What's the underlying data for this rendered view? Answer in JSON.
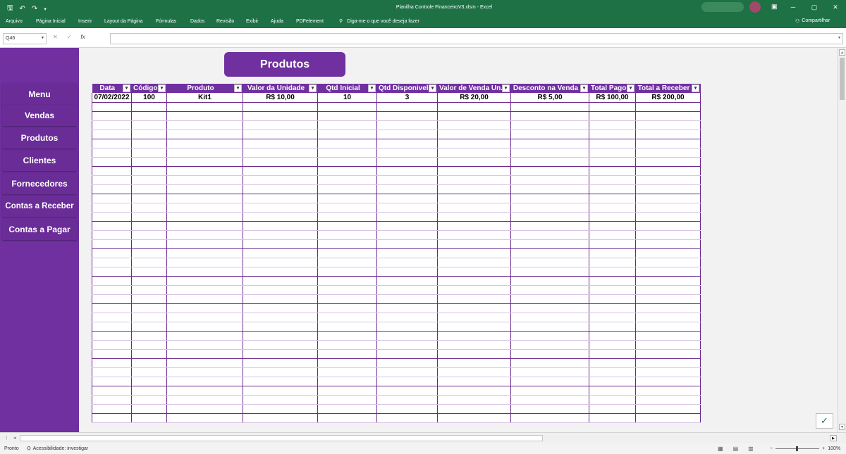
{
  "window": {
    "title": "Planilha Controle FinanceiroV3.xlsm  -  Excel",
    "qat_icons": [
      "save-icon",
      "undo-icon",
      "redo-icon",
      "customize-icon"
    ],
    "controls": [
      "ribbon-display-icon",
      "minimize-icon",
      "restore-icon",
      "close-icon"
    ]
  },
  "ribbon": {
    "tabs": [
      "Arquivo",
      "Página Inicial",
      "Inserir",
      "Layout da Página",
      "Fórmulas",
      "Dados",
      "Revisão",
      "Exibir",
      "Ajuda",
      "PDFelement"
    ],
    "tell_me": "Diga-me o que você deseja fazer",
    "share": "Compartilhar"
  },
  "formula_bar": {
    "name_box": "Q46",
    "cancel": "✕",
    "enter": "✓",
    "fx": "fx",
    "value": ""
  },
  "sidebar": {
    "items": [
      "Menu",
      "Vendas",
      "Produtos",
      "Clientes",
      "Fornecedores",
      "Contas a Receber",
      "Contas a Pagar"
    ]
  },
  "page_title": "Produtos",
  "table": {
    "headers": [
      "Data",
      "Código",
      "Produto",
      "Valor da Unidade",
      "Qtd Inicial",
      "Qtd Disponivel",
      "Valor de Venda Un.",
      "Desconto na Venda",
      "Total Pago",
      "Total a Receber"
    ],
    "rows": [
      [
        "07/02/2022",
        "100",
        "Kit1",
        "R$ 10,00",
        "10",
        "3",
        "R$ 20,00",
        "R$ 5,00",
        "R$ 100,00",
        "R$ 200,00"
      ]
    ],
    "empty_rows": 35
  },
  "status": {
    "ready": "Pronto",
    "accessibility": "Acessibilidade: investigar",
    "zoom": "100%",
    "zoom_minus": "−",
    "zoom_plus": "+"
  },
  "colors": {
    "excel_green": "#1e7145",
    "purple": "#7030a0",
    "row_border": "#d9c3e6"
  }
}
